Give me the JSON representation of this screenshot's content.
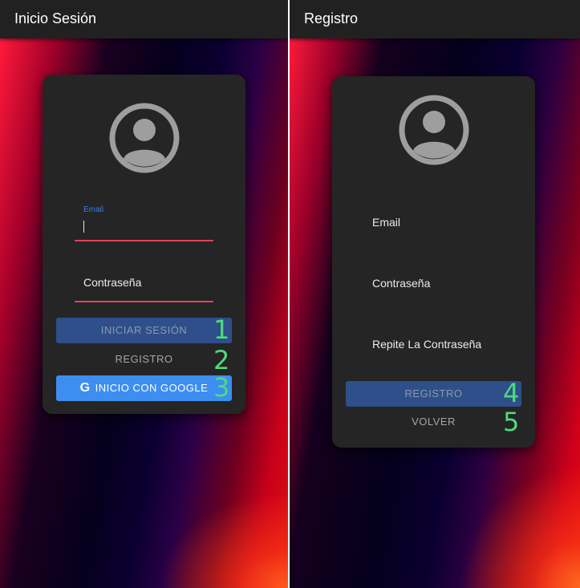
{
  "login_screen": {
    "title": "Inicio Sesión",
    "email_label": "Email",
    "password_label": "Contraseña",
    "login_button": "INICIAR SESIÓN",
    "register_button": "REGISTRO",
    "google_button": "INICIO CON GOOGLE",
    "annotations": [
      "1",
      "2",
      "3"
    ]
  },
  "register_screen": {
    "title": "Registro",
    "email_label": "Email",
    "password_label": "Contraseña",
    "repeat_password_label": "Repite La Contraseña",
    "register_button": "REGISTRO",
    "back_button": "VOLVER",
    "annotations": [
      "4",
      "5"
    ]
  },
  "colors": {
    "appbar": "#212121",
    "card": "#252525",
    "primary_disabled": "#2f4f8a",
    "google_blue": "#3d8ef0",
    "field_underline": "#e0445a",
    "annotation_green": "#4cdd7a"
  },
  "icons": [
    "account-circle-icon",
    "google-g-icon"
  ]
}
